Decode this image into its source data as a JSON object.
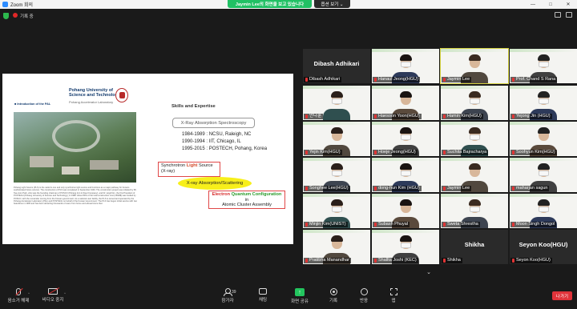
{
  "window": {
    "title": "Zoom 회의",
    "controls": [
      "—",
      "□",
      "✕"
    ]
  },
  "share_banner": "Jaymin Lee의 화면을 보고 있습니다",
  "view_options": "옵션 보기 ⌄",
  "recording": "기록 중",
  "slide": {
    "university": [
      "Pohang University of",
      "Science and Technology"
    ],
    "lab": "Pohang Accelerator Laboratory",
    "intro": "■ Introduction of the PAL",
    "paragraph": "Pohang Light Source (PLS) is the nation's one and only synchrotron light source and functions as a major pathway for Korea's sophisticated future science. The construction of PLS was completed in September 1994. The construction project was initiated by Mr. Tae-Joon Park, who was the founding chairman of POSCO (Pohang Iron & Steel Company), and Dr. Hogil Kim, the first President of POSTECH (Pohang University of Science and Technology), in 1988. About 80% of the total construction cost (150M$) was funded by POSCO, with the remainder coming from the Korean government. As a national user facility, the PLS is owned and operated by the Pohang Accelerator Laboratory (PAL) and POSTECH on behalf of the Korean Government. The PLS has begun initial service with two beamlines in 1995 and has been attracting thousands of users from home and abroad since then.",
    "skills_title": "Skills and Expertise",
    "xas": "X-Ray Absorption Spectroscopy",
    "career": [
      "1984-1989 : NCSU, Raleigh, NC",
      "1990-1994 : IIT, Chicago, IL",
      "1995-2015 : POSTECH, Pohang, Korea"
    ],
    "sync_pre": "Synchrotron ",
    "sync_light": "Light",
    "sync_post": " Source",
    "sync_line2": "(X-ray)",
    "xray": "X-ray Absorption/Scattering",
    "config_e": "Electron",
    "config_q": "Quantum Configuration",
    "config_in": "in",
    "config_last": "Atomic Cluster Assembly"
  },
  "participants": [
    {
      "name": "Dibash Adhikari",
      "video": false,
      "big": "Dibash Adhikari"
    },
    {
      "name": "Hanaul Jeong(HGU)",
      "video": true
    },
    {
      "name": "Jaymin Lee",
      "video": true,
      "active": true
    },
    {
      "name": "Prof. Chand S Rana",
      "video": true
    },
    {
      "name": "안다훈",
      "video": true
    },
    {
      "name": "Haesoon Yoon(HGU)",
      "video": true
    },
    {
      "name": "Hamin Kim(HGU)",
      "video": true
    },
    {
      "name": "Yejong Jin (HGU)",
      "video": true
    },
    {
      "name": "Yejin Kim(HGU)",
      "video": true
    },
    {
      "name": "Hoeje Jeong(HGU)",
      "video": true
    },
    {
      "name": "Suchita Bajracharya",
      "video": true
    },
    {
      "name": "Soohyun Kim(HGU)",
      "video": true
    },
    {
      "name": "Songhee Lee(HGU)",
      "video": true
    },
    {
      "name": "dong-hun Kim (HGU)",
      "video": true
    },
    {
      "name": "Jaymin Lee",
      "video": true
    },
    {
      "name": "maharjan sagun",
      "video": true
    },
    {
      "name": "Minjin Kim(UNIST)",
      "video": true
    },
    {
      "name": "Subash Phuyal",
      "video": true
    },
    {
      "name": "Sweta Shrestha",
      "video": true
    },
    {
      "name": "Moon Singh Dongol",
      "video": true
    },
    {
      "name": "Pratibha Manandhar",
      "video": true
    },
    {
      "name": "Shallta Joshi (KEC)",
      "video": true
    },
    {
      "name": "Shikha",
      "video": false,
      "big": "Shikha"
    },
    {
      "name": "Seyon Koo(HGU)",
      "video": false,
      "big": "Seyon Koo(HGU)"
    }
  ],
  "toolbar": {
    "mute": "음소거 해제",
    "video": "비디오 중지",
    "participants": "참가자",
    "participant_count": "39",
    "chat": "채팅",
    "share": "화면 공유",
    "record": "기록",
    "reactions": "반응",
    "apps": "앱",
    "leave": "나가기"
  }
}
